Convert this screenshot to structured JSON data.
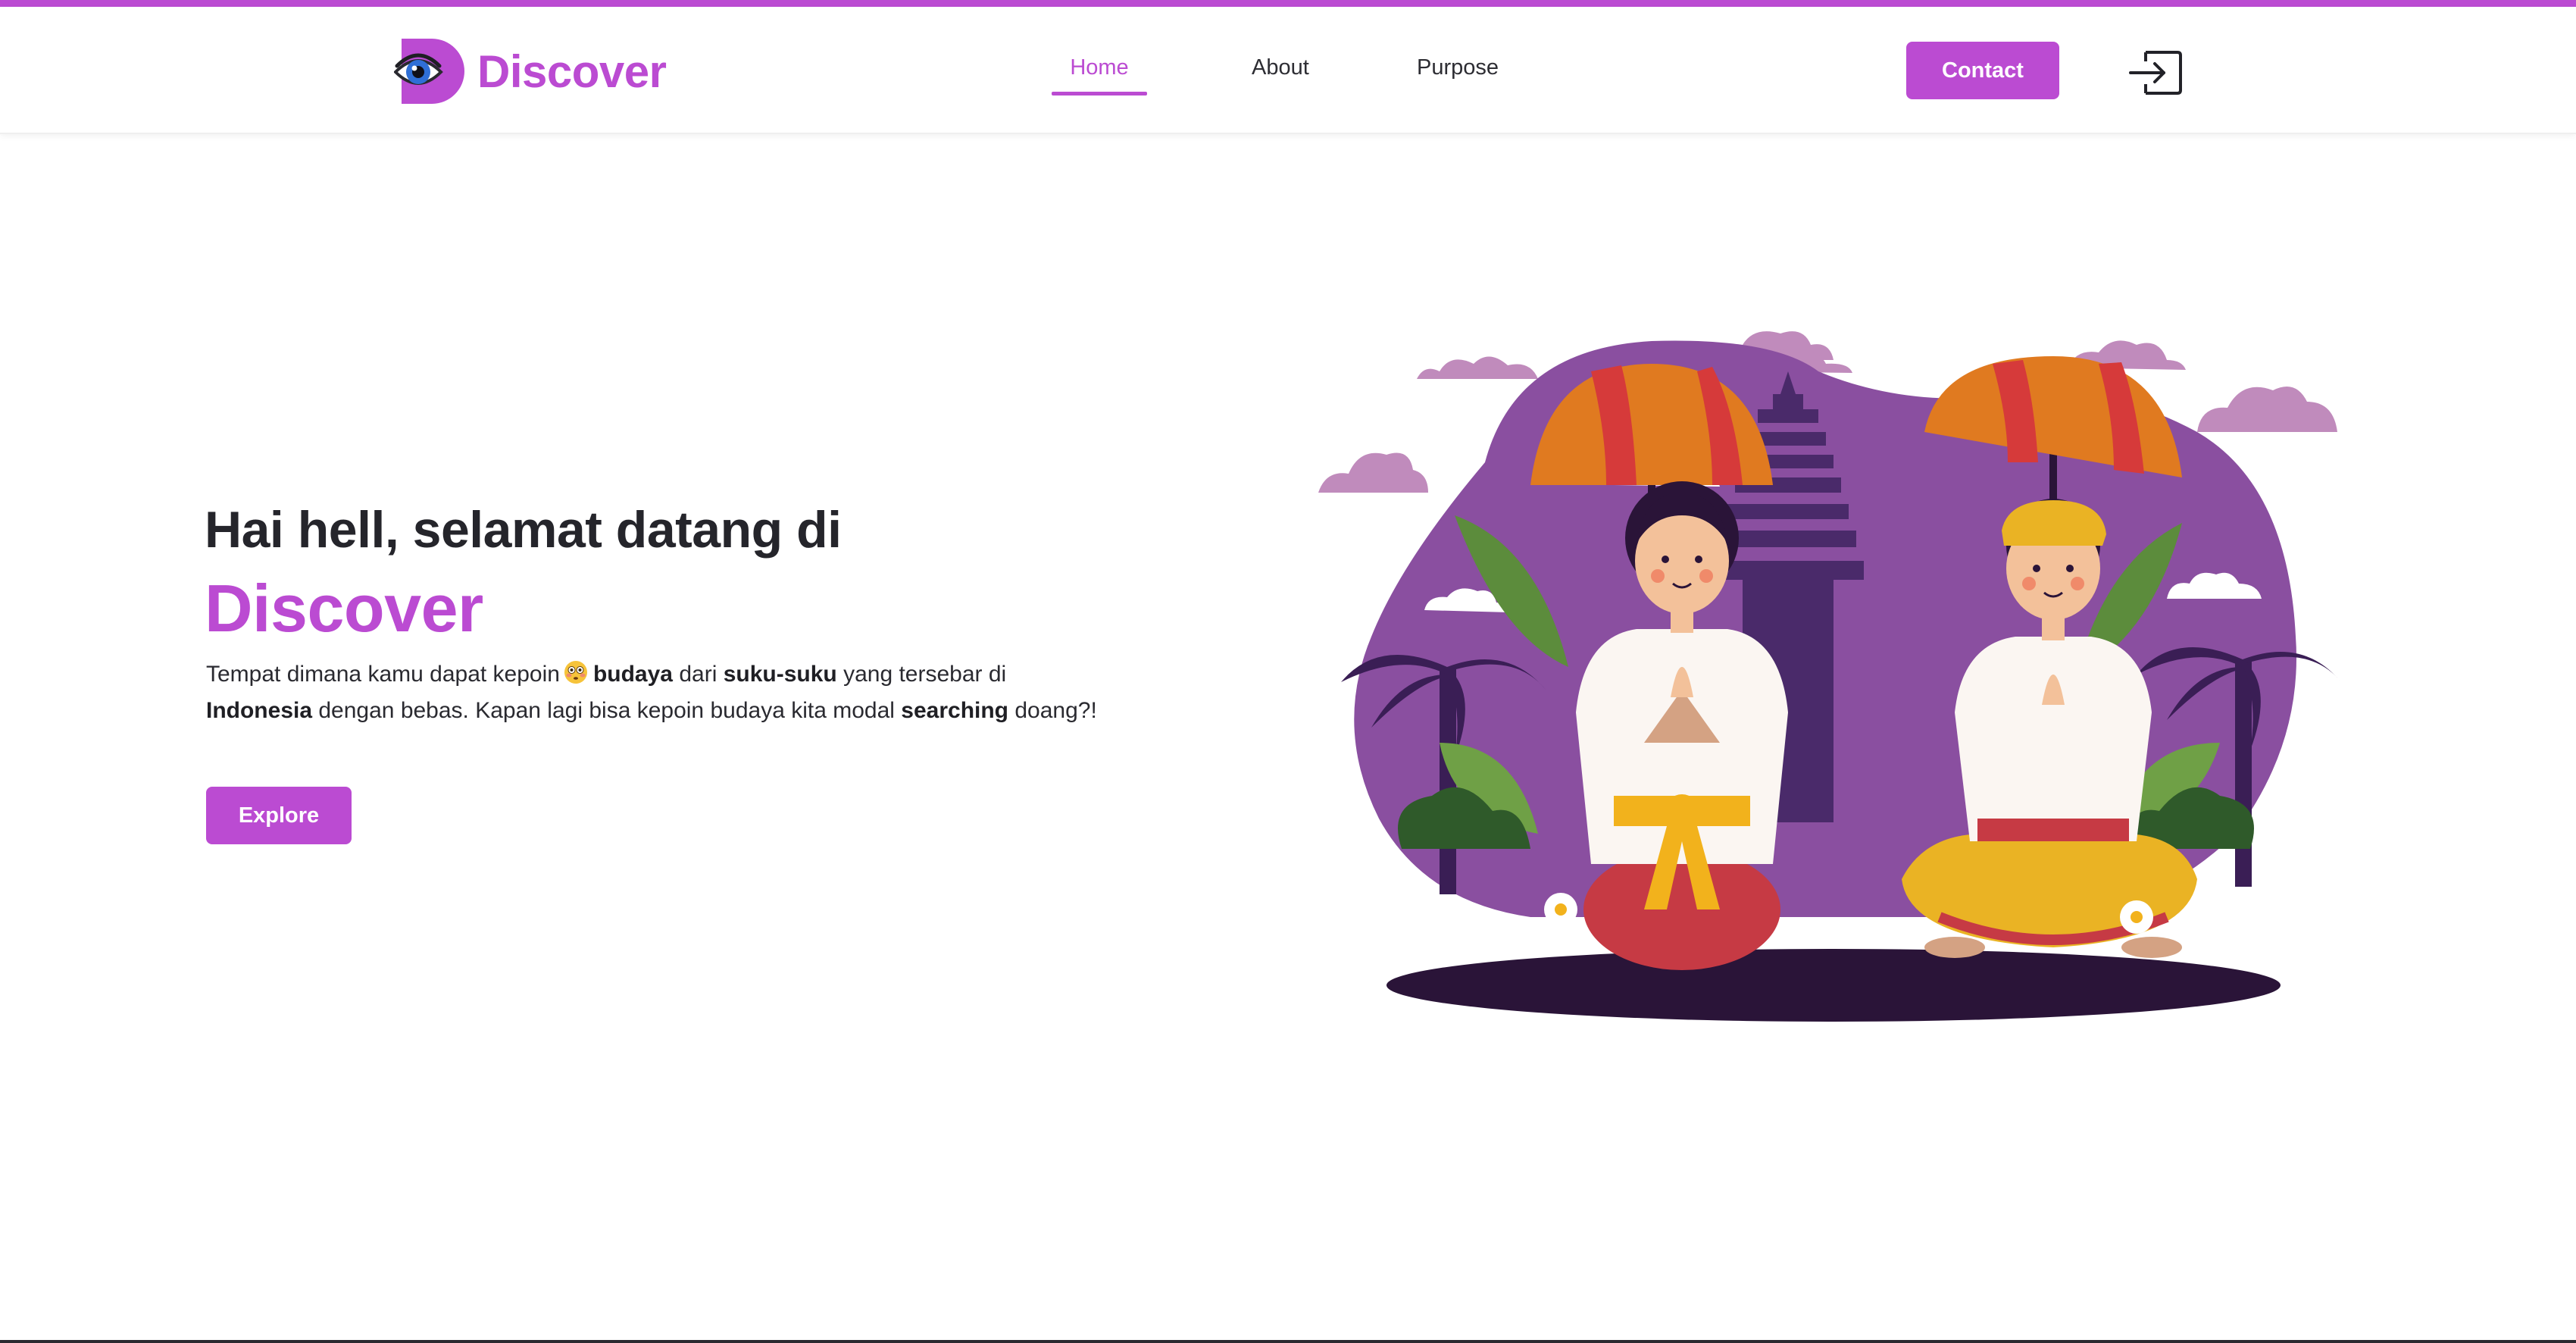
{
  "brand": {
    "name": "Discover",
    "accent_color": "#bb4bd2"
  },
  "nav": {
    "items": [
      {
        "label": "Home",
        "active": true
      },
      {
        "label": "About",
        "active": false
      },
      {
        "label": "Purpose",
        "active": false
      }
    ],
    "contact_label": "Contact",
    "login_icon": "login-icon"
  },
  "hero": {
    "title": "Hai hell, selamat datang di",
    "brand": "Discover",
    "desc": {
      "t1": "Tempat dimana kamu dapat kepoin",
      "emoji": "flushed-face-emoji",
      "b1": "budaya",
      "t2": "dari",
      "b2": "suku-suku",
      "t3": "yang tersebar di",
      "b3": "Indonesia",
      "t4": "dengan bebas. Kapan lagi bisa kepoin budaya kita modal",
      "b4": "searching",
      "t5": "doang?!"
    },
    "explore_label": "Explore"
  },
  "illustration": {
    "subject": "balinese-couple-praying-illustration",
    "colors": {
      "blob": "#8a4fa0",
      "cloud": "#c08bbc",
      "ground": "#2a1438",
      "leaf": "#5c8c3c",
      "umbrella": "#e07a20"
    }
  }
}
